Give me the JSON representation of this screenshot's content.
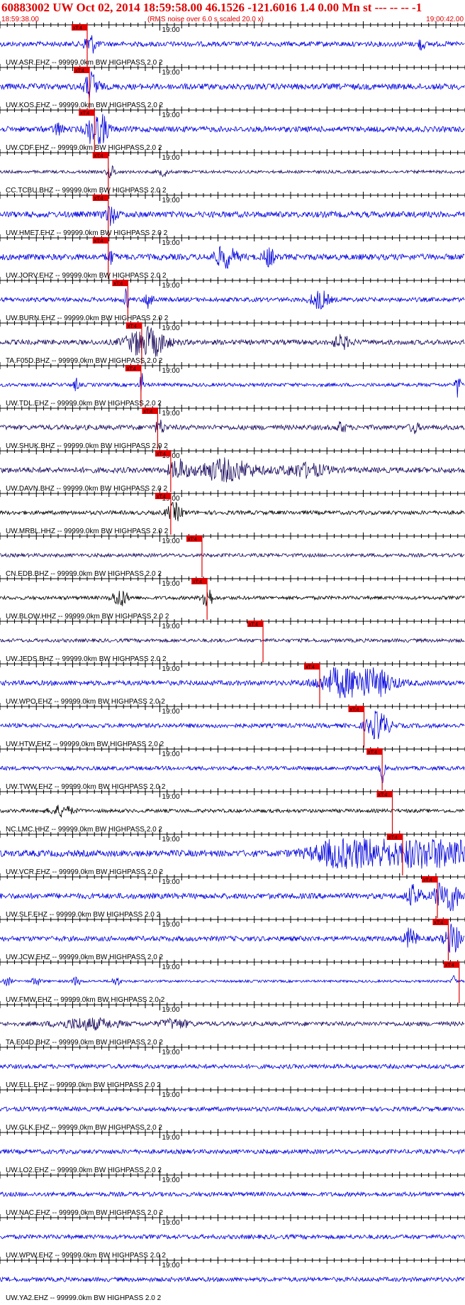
{
  "header": {
    "title": "60883002 UW Oct 02, 2014 18:59:58.00   46.1526 -121.6016  1.4 0.00 Mn st --- -- --   -1",
    "start_time": "18:59:38.00",
    "noise_note": "(RMS noise over 6.0 s scaled 20.0 x)",
    "end_time": "19:00:42.00"
  },
  "colors": {
    "header_red": "#e00000",
    "pick_red": "#e00000",
    "trace_blue": "#0000dd",
    "trace_navy": "#1a0a5c",
    "trace_black": "#000000",
    "axis": "#000000"
  },
  "chart_data": {
    "type": "line",
    "title": "60883002 UW Oct 02, 2014 18:59:58.00   46.1526 -121.6016  1.4 0.00 Mn st --- -- --   -1",
    "x_start": "18:59:38.00",
    "x_end": "19:00:42.00",
    "x_range_seconds": [
      0,
      64
    ],
    "tick_interval_seconds": 1,
    "minute_label": "19:00",
    "minute_label_offset_seconds": 22,
    "pick_marker_label": "xT:4",
    "series": [
      {
        "name": "UW.ASR.EHZ -- 99999.0km BW  HIGHPASS  2.0  2",
        "color": "blue",
        "pick_s": 12.0,
        "noise": 0.25,
        "bursts": [
          [
            12.4,
            1.0,
            0.8
          ],
          [
            58,
            0.6,
            0.4
          ]
        ]
      },
      {
        "name": "UW.KOS.EHZ -- 99999.0km BW  HIGHPASS  2.0  2",
        "color": "blue",
        "pick_s": 12.3,
        "noise": 0.3,
        "bursts": [
          [
            12.6,
            1.5,
            0.9
          ]
        ]
      },
      {
        "name": "UW.CDF.EHZ -- 99999.0km BW  HIGHPASS  2.0  2",
        "color": "blue",
        "pick_s": 13.0,
        "noise": 0.28,
        "bursts": [
          [
            13.4,
            2.5,
            1.2
          ],
          [
            8,
            0.6,
            0.6
          ]
        ]
      },
      {
        "name": "CC.TCBU.BHZ -- 99999.0km BW  HIGHPASS  2.0  2",
        "color": "navy",
        "pick_s": 14.9,
        "noise": 0.15,
        "bursts": [
          [
            15.3,
            0.6,
            0.6
          ],
          [
            22.5,
            0.4,
            0.6
          ]
        ]
      },
      {
        "name": "UW.HMET.EHZ -- 99999.0km BW  HIGHPASS  2.0  2",
        "color": "blue",
        "pick_s": 14.9,
        "noise": 0.3,
        "bursts": [
          [
            15.2,
            0.9,
            0.8
          ]
        ]
      },
      {
        "name": "UW.JORV.EHZ -- 99999.0km BW  HIGHPASS  2.0  2",
        "color": "blue",
        "pick_s": 14.9,
        "noise": 0.3,
        "bursts": [
          [
            31,
            1.0,
            1.5
          ],
          [
            37,
            0.9,
            0.7
          ],
          [
            15.2,
            0.6,
            0.5
          ]
        ]
      },
      {
        "name": "UW.BURN.EHZ -- 99999.0km BW  HIGHPASS  2.0  2",
        "color": "blue",
        "pick_s": 17.6,
        "noise": 0.22,
        "bursts": [
          [
            17.4,
            1.2,
            0.3
          ],
          [
            20.5,
            1.0,
            0.5
          ],
          [
            44,
            0.9,
            1.2
          ]
        ]
      },
      {
        "name": "TA.F05D.BHZ -- 99999.0km BW  HIGHPASS  2.0  2",
        "color": "navy",
        "pick_s": 19.5,
        "noise": 0.25,
        "bursts": [
          [
            20.2,
            1.6,
            2.5
          ],
          [
            47,
            0.6,
            1.2
          ]
        ]
      },
      {
        "name": "UW.TDL.EHZ -- 99999.0km BW  HIGHPASS  2.0  2",
        "color": "blue",
        "pick_s": 19.4,
        "noise": 0.18,
        "bursts": [
          [
            19.5,
            1.1,
            0.3
          ],
          [
            10.5,
            0.7,
            0.3
          ],
          [
            63,
            1.3,
            0.3
          ]
        ]
      },
      {
        "name": "UW.SHUK.BHZ -- 99999.0km BW  HIGHPASS  2.0  2",
        "color": "navy",
        "pick_s": 21.7,
        "noise": 0.25,
        "bursts": [
          [
            22.0,
            0.7,
            0.6
          ],
          [
            47,
            0.5,
            0.6
          ],
          [
            57,
            0.5,
            0.6
          ]
        ]
      },
      {
        "name": "UW.DAVN.BHZ -- 99999.0km BW  HIGHPASS  2.0  2",
        "color": "navy",
        "pick_s": 23.5,
        "noise": 0.28,
        "bursts": [
          [
            24.5,
            0.9,
            1.2
          ],
          [
            31,
            1.0,
            4.0
          ],
          [
            42,
            0.6,
            3.0
          ]
        ]
      },
      {
        "name": "UW.MRBL.HHZ -- 99999.0km BW  HIGHPASS  2.0  2",
        "color": "black",
        "pick_s": 23.5,
        "noise": 0.2,
        "bursts": [
          [
            24.0,
            0.9,
            1.0
          ]
        ]
      },
      {
        "name": "CN.EDB.BHZ -- 99999.0km BW  HIGHPASS  2.0  2",
        "color": "navy",
        "pick_s": 27.8,
        "noise": 0.18,
        "bursts": []
      },
      {
        "name": "UW.BLOW.HHZ -- 99999.0km BW  HIGHPASS  2.0  2",
        "color": "black",
        "pick_s": 28.5,
        "noise": 0.18,
        "bursts": [
          [
            16.5,
            0.9,
            1.0
          ],
          [
            28.5,
            1.5,
            0.6
          ]
        ]
      },
      {
        "name": "UW.JEDS.BHZ -- 99999.0km BW  HIGHPASS  2.0  2",
        "color": "navy",
        "pick_s": 36.2,
        "noise": 0.18,
        "bursts": []
      },
      {
        "name": "UW.WPO.EHZ -- 99999.0km BW  HIGHPASS  2.0  2",
        "color": "blue",
        "pick_s": 44.0,
        "noise": 0.25,
        "bursts": [
          [
            49,
            2.5,
            4.0
          ]
        ]
      },
      {
        "name": "UW.HTW.EHZ -- 99999.0km BW  HIGHPASS  2.0  2",
        "color": "blue",
        "pick_s": 50.1,
        "noise": 0.22,
        "bursts": [
          [
            52,
            1.4,
            1.5
          ]
        ]
      },
      {
        "name": "UW.TWW.EHZ -- 99999.0km BW  HIGHPASS  2.0  2",
        "color": "blue",
        "pick_s": 52.6,
        "noise": 0.2,
        "bursts": [
          [
            52.6,
            1.4,
            0.3
          ]
        ]
      },
      {
        "name": "NC.LMC.HHZ -- 99999.0km BW  HIGHPASS  2.0  2",
        "color": "black",
        "pick_s": 54.0,
        "noise": 0.18,
        "bursts": [
          [
            8.5,
            0.5,
            1.5
          ]
        ]
      },
      {
        "name": "UW.VCR.EHZ -- 99999.0km BW  HIGHPASS  2.0  2",
        "color": "blue",
        "pick_s": 55.4,
        "noise": 0.32,
        "bursts": [
          [
            49,
            2.0,
            5.0
          ],
          [
            60,
            2.5,
            4.0
          ]
        ]
      },
      {
        "name": "UW.SLF.EHZ -- 99999.0km BW  HIGHPASS  2.0  2",
        "color": "blue",
        "pick_s": 60.2,
        "noise": 0.28,
        "bursts": [
          [
            61.5,
            2.0,
            1.5
          ],
          [
            57,
            1.0,
            1.0
          ]
        ]
      },
      {
        "name": "UW.JCW.EHZ -- 99999.0km BW  HIGHPASS  2.0  2",
        "color": "blue",
        "pick_s": 61.7,
        "noise": 0.25,
        "bursts": [
          [
            62.3,
            1.5,
            1.0
          ],
          [
            56.5,
            1.0,
            0.8
          ]
        ]
      },
      {
        "name": "UW.FMW.EHZ -- 99999.0km BW  HIGHPASS  2.0  2",
        "color": "blue",
        "pick_s": 63.2,
        "noise": 0.12,
        "bursts": [
          [
            1,
            0.4,
            0.6
          ],
          [
            5,
            0.4,
            0.6
          ],
          [
            10.5,
            0.4,
            0.6
          ],
          [
            16,
            0.4,
            0.6
          ],
          [
            62.5,
            0.6,
            0.3
          ]
        ]
      },
      {
        "name": "TA.E04D.BHZ -- 99999.0km BW  HIGHPASS  2.0  2",
        "color": "navy",
        "pick_s": null,
        "noise": 0.22,
        "bursts": [
          [
            12,
            0.5,
            4.0
          ],
          [
            24,
            0.4,
            2.0
          ]
        ]
      },
      {
        "name": "UW.ELL.EHZ -- 99999.0km BW  HIGHPASS  2.0  2",
        "color": "blue",
        "pick_s": null,
        "noise": 0.22,
        "bursts": []
      },
      {
        "name": "UW.GLK.EHZ -- 99999.0km BW  HIGHPASS  2.0  2",
        "color": "blue",
        "pick_s": null,
        "noise": 0.22,
        "bursts": []
      },
      {
        "name": "UW.LO2.EHZ -- 99999.0km BW  HIGHPASS  2.0  2",
        "color": "blue",
        "pick_s": null,
        "noise": 0.22,
        "bursts": []
      },
      {
        "name": "UW.NAC.EHZ -- 99999.0km BW  HIGHPASS  2.0  2",
        "color": "blue",
        "pick_s": null,
        "noise": 0.22,
        "bursts": []
      },
      {
        "name": "UW.WPW.EHZ -- 99999.0km BW  HIGHPASS  2.0  2",
        "color": "blue",
        "pick_s": null,
        "noise": 0.22,
        "bursts": []
      },
      {
        "name": "UW.YA2.EHZ -- 99999.0km BW  HIGHPASS  2.0  2",
        "color": "blue",
        "pick_s": null,
        "noise": 0.22,
        "bursts": []
      }
    ]
  }
}
